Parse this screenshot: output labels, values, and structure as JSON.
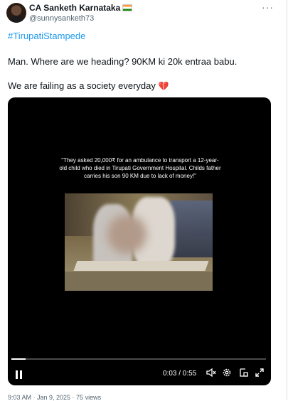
{
  "author": {
    "display_name": "CA Sanketh Karnataka",
    "handle": "@sunnysanketh73",
    "flag_icon": "india-flag-icon"
  },
  "post": {
    "hashtag": "#TirupatiStampede",
    "line1": "Man. Where are we heading? 90KM ki 20k entraa babu.",
    "line2": "We are failing as a society everyday",
    "emoji": "💔"
  },
  "video": {
    "caption": "\"They asked 20,000₹ for an ambulance to transport a 12-year-old child who died in Tirupati Government Hospital. Childs father carries his son 90 KM due to lack of money!\"",
    "time_display": "0:03 / 0:55",
    "progress_fraction": 0.055
  },
  "footer": {
    "meta": "9:03 AM · Jan 9, 2025 · 75 views"
  },
  "colors": {
    "link": "#1d9bf0",
    "text": "#0f1419",
    "muted": "#536471",
    "video_bg": "#000000"
  }
}
